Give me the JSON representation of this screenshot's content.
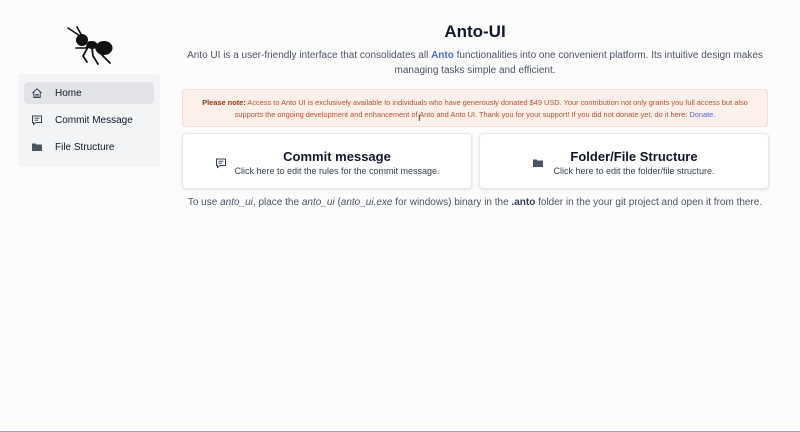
{
  "app": {
    "title": "Anto-UI",
    "subtitle_pre": "Anto UI is a user-friendly interface that consolidates all",
    "subtitle_brand": "Anto",
    "subtitle_post": "functionalities into one convenient platform. Its intuitive design makes managing tasks simple and efficient."
  },
  "sidebar": {
    "items": [
      {
        "label": "Home",
        "icon": "home-icon",
        "active": true
      },
      {
        "label": "Commit Message",
        "icon": "message-icon",
        "active": false
      },
      {
        "label": "File Structure",
        "icon": "folder-icon",
        "active": false
      }
    ]
  },
  "notice": {
    "prefix": "Please note:",
    "text": "Access to Anto UI is exclusively available to individuals who have generously donated $49 USD. Your contribution not only grants you full access but also supports the ongoing development and enhancement of Anto and Anto UI. Thank you for your support! If you did not donate yet, do it here:",
    "link": "Donate."
  },
  "cards": [
    {
      "title": "Commit message",
      "description": "Click here to edit the rules for the commit message.",
      "icon": "message-icon"
    },
    {
      "title": "Folder/File Structure",
      "description": "Click here to edit the folder/file structure.",
      "icon": "folder-icon"
    }
  ],
  "usage": {
    "p1": "To use",
    "p2": "anto_ui",
    "p3": ", place the",
    "p4": "anto_ui",
    "p5": "(",
    "p6": "anto_ui.exe",
    "p7": "for windows) binary in the",
    "p8": ".anto",
    "p9": "folder in the your git project and open it from there."
  },
  "colors": {
    "accent": "#4f6bd8",
    "notice_bg": "#fdefe9",
    "notice_text": "#b45435",
    "sidebar_bg": "#f3f4f6",
    "active_item_bg": "#e1e3e7"
  }
}
